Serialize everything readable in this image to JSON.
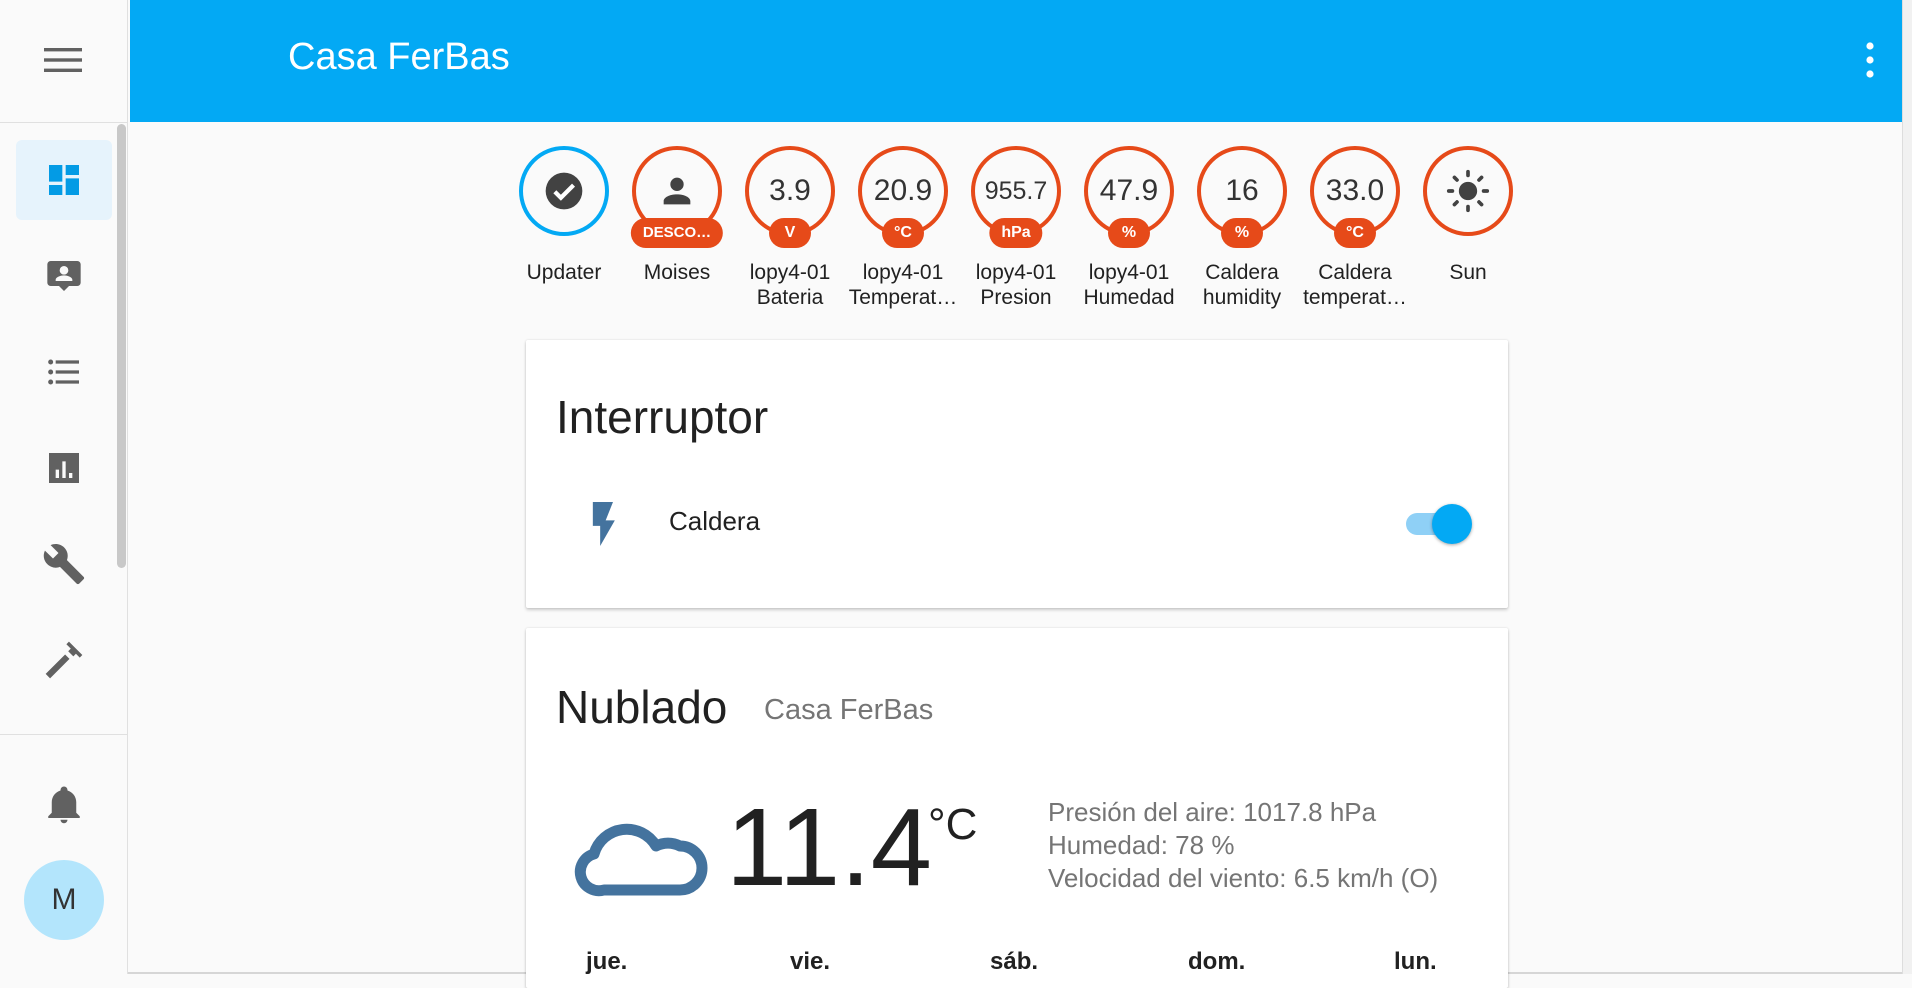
{
  "header": {
    "title": "Casa FerBas"
  },
  "sidebar": {
    "items": [
      {
        "icon": "dashboard-icon"
      },
      {
        "icon": "map-marker-account-icon"
      },
      {
        "icon": "list-icon"
      },
      {
        "icon": "chart-bar-icon"
      },
      {
        "icon": "wrench-icon"
      },
      {
        "icon": "hammer-icon"
      }
    ],
    "notifications_icon": "bell-icon",
    "avatar_initial": "M"
  },
  "badges": [
    {
      "label1": "Updater",
      "label2": "",
      "icon": "check-circle-icon",
      "color": "#03a9f4"
    },
    {
      "label1": "Moises",
      "label2": "",
      "icon": "account-icon",
      "unit": "DESCO…"
    },
    {
      "label1": "lopy4-01",
      "label2": "Bateria",
      "value": "3.9",
      "unit": "V"
    },
    {
      "label1": "lopy4-01",
      "label2": "Temperat…",
      "value": "20.9",
      "unit": "°C"
    },
    {
      "label1": "lopy4-01",
      "label2": "Presion",
      "value": "955.7",
      "unit": "hPa"
    },
    {
      "label1": "lopy4-01",
      "label2": "Humedad",
      "value": "47.9",
      "unit": "%"
    },
    {
      "label1": "Caldera",
      "label2": "humidity",
      "value": "16",
      "unit": "%"
    },
    {
      "label1": "Caldera",
      "label2": "temperat…",
      "value": "33.0",
      "unit": "°C"
    },
    {
      "label1": "Sun",
      "label2": "",
      "icon": "sun-icon"
    }
  ],
  "switch_card": {
    "title": "Interruptor",
    "entity": "Caldera",
    "state_on": true
  },
  "weather_card": {
    "condition": "Nublado",
    "location": "Casa FerBas",
    "temperature": "11.4",
    "unit": "°C",
    "pressure": "Presión del aire: 1017.8 hPa",
    "humidity": "Humedad: 78 %",
    "wind": "Velocidad del viento: 6.5 km/h (O)",
    "forecast_days": [
      "jue.",
      "vie.",
      "sáb.",
      "dom.",
      "lun."
    ]
  },
  "colors": {
    "header": "#03a9f4",
    "badge_border": "#e64a19",
    "accent": "#03a9f4"
  }
}
